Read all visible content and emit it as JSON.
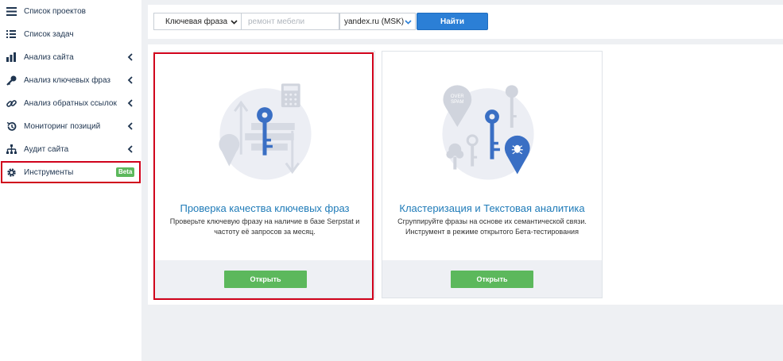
{
  "sidebar": {
    "items": [
      {
        "label": "Список проектов",
        "icon": "menu-icon",
        "has_chevron": false
      },
      {
        "label": "Список задач",
        "icon": "list-icon",
        "has_chevron": false
      },
      {
        "label": "Анализ сайта",
        "icon": "chart-icon",
        "has_chevron": true
      },
      {
        "label": "Анализ ключевых фраз",
        "icon": "key-icon",
        "has_chevron": true
      },
      {
        "label": "Анализ обратных ссылок",
        "icon": "link-icon",
        "has_chevron": true
      },
      {
        "label": "Мониторинг позиций",
        "icon": "history-icon",
        "has_chevron": true
      },
      {
        "label": "Аудит сайта",
        "icon": "sitemap-icon",
        "has_chevron": true
      },
      {
        "label": "Инструменты",
        "icon": "gear-icon",
        "has_chevron": false,
        "badge": "Beta",
        "active": true
      }
    ]
  },
  "search": {
    "type_label": "Ключевая фраза",
    "input_value": "",
    "input_placeholder": "ремонт мебели",
    "database_label": "yandex.ru (MSK)",
    "find_label": "Найти"
  },
  "cards": [
    {
      "title": "Проверка качества ключевых фраз",
      "desc_line1": "Проверьте ключевую фразу на наличие в базе Serpstat и",
      "desc_line2": "частоту её запросов за месяц.",
      "button": "Открыть",
      "highlighted": true
    },
    {
      "title": "Кластеризация и Текстовая аналитика",
      "desc_line1": "Сгруппируйте фразы на основе их семантической связи.",
      "desc_line2": "Инструмент в режиме открытого Бета-тестирования",
      "button": "Открыть",
      "illustration_text": [
        "OVER",
        "SPAM"
      ]
    }
  ],
  "colors": {
    "accent_blue": "#2b7fd6",
    "link_blue": "#1f7bb8",
    "icon_blue": "#3a6fc4",
    "green": "#5cb85c",
    "highlight_red": "#d0021b"
  }
}
